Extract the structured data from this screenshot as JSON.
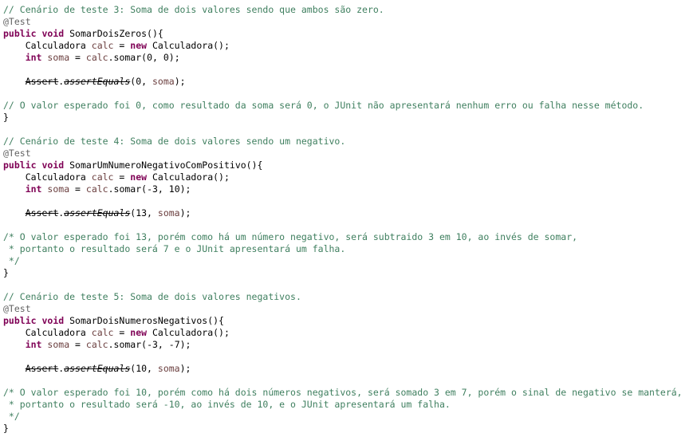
{
  "colors": {
    "background": "#ffffff",
    "comment": "#3f7f5f",
    "annotation": "#646464",
    "keyword": "#7f0055",
    "variable": "#6a3e3e",
    "plain": "#000000"
  },
  "code_lines": [
    [
      {
        "t": "// Cenário de teste 3: Soma de dois valores sendo que ambos são zero.",
        "c": "comment"
      }
    ],
    [
      {
        "t": "@Test",
        "c": "annotation"
      }
    ],
    [
      {
        "t": "public",
        "c": "keyword"
      },
      {
        "t": " ",
        "c": "plain"
      },
      {
        "t": "void",
        "c": "keyword"
      },
      {
        "t": " SomarDoisZeros(){",
        "c": "plain"
      }
    ],
    [
      {
        "t": "    Calculadora ",
        "c": "plain"
      },
      {
        "t": "calc",
        "c": "var"
      },
      {
        "t": " = ",
        "c": "plain"
      },
      {
        "t": "new",
        "c": "keyword"
      },
      {
        "t": " Calculadora();",
        "c": "plain"
      }
    ],
    [
      {
        "t": "    ",
        "c": "plain"
      },
      {
        "t": "int",
        "c": "keyword"
      },
      {
        "t": " ",
        "c": "plain"
      },
      {
        "t": "soma",
        "c": "var"
      },
      {
        "t": " = ",
        "c": "plain"
      },
      {
        "t": "calc",
        "c": "var"
      },
      {
        "t": ".somar(0, 0);",
        "c": "plain"
      }
    ],
    [],
    [
      {
        "t": "    ",
        "c": "plain"
      },
      {
        "t": "Assert",
        "c": "deprecated"
      },
      {
        "t": ".",
        "c": "plain"
      },
      {
        "t": "assertEquals",
        "c": "deprecated-italic"
      },
      {
        "t": "(0, ",
        "c": "plain"
      },
      {
        "t": "soma",
        "c": "var"
      },
      {
        "t": ");",
        "c": "plain"
      }
    ],
    [],
    [
      {
        "t": "// O valor esperado foi 0, como resultado da soma será 0, o JUnit não apresentará nenhum erro ou falha nesse método.",
        "c": "comment"
      }
    ],
    [
      {
        "t": "}",
        "c": "plain"
      }
    ],
    [],
    [
      {
        "t": "// Cenário de teste 4: Soma de dois valores sendo um negativo.",
        "c": "comment"
      }
    ],
    [
      {
        "t": "@Test",
        "c": "annotation"
      }
    ],
    [
      {
        "t": "public",
        "c": "keyword"
      },
      {
        "t": " ",
        "c": "plain"
      },
      {
        "t": "void",
        "c": "keyword"
      },
      {
        "t": " SomarUmNumeroNegativoComPositivo(){",
        "c": "plain"
      }
    ],
    [
      {
        "t": "    Calculadora ",
        "c": "plain"
      },
      {
        "t": "calc",
        "c": "var"
      },
      {
        "t": " = ",
        "c": "plain"
      },
      {
        "t": "new",
        "c": "keyword"
      },
      {
        "t": " Calculadora();",
        "c": "plain"
      }
    ],
    [
      {
        "t": "    ",
        "c": "plain"
      },
      {
        "t": "int",
        "c": "keyword"
      },
      {
        "t": " ",
        "c": "plain"
      },
      {
        "t": "soma",
        "c": "var"
      },
      {
        "t": " = ",
        "c": "plain"
      },
      {
        "t": "calc",
        "c": "var"
      },
      {
        "t": ".somar(-3, 10);",
        "c": "plain"
      }
    ],
    [],
    [
      {
        "t": "    ",
        "c": "plain"
      },
      {
        "t": "Assert",
        "c": "deprecated"
      },
      {
        "t": ".",
        "c": "plain"
      },
      {
        "t": "assertEquals",
        "c": "deprecated-italic"
      },
      {
        "t": "(13, ",
        "c": "plain"
      },
      {
        "t": "soma",
        "c": "var"
      },
      {
        "t": ");",
        "c": "plain"
      }
    ],
    [],
    [
      {
        "t": "/* O valor esperado foi 13, porém como há um número negativo, será subtraido 3 em 10, ao invés de somar,",
        "c": "comment"
      }
    ],
    [
      {
        "t": " * portanto o resultado será 7 e o JUnit apresentará um falha.",
        "c": "comment"
      }
    ],
    [
      {
        "t": " */",
        "c": "comment"
      }
    ],
    [
      {
        "t": "}",
        "c": "plain"
      }
    ],
    [],
    [
      {
        "t": "// Cenário de teste 5: Soma de dois valores negativos.",
        "c": "comment"
      }
    ],
    [
      {
        "t": "@Test",
        "c": "annotation"
      }
    ],
    [
      {
        "t": "public",
        "c": "keyword"
      },
      {
        "t": " ",
        "c": "plain"
      },
      {
        "t": "void",
        "c": "keyword"
      },
      {
        "t": " SomarDoisNumerosNegativos(){",
        "c": "plain"
      }
    ],
    [
      {
        "t": "    Calculadora ",
        "c": "plain"
      },
      {
        "t": "calc",
        "c": "var"
      },
      {
        "t": " = ",
        "c": "plain"
      },
      {
        "t": "new",
        "c": "keyword"
      },
      {
        "t": " Calculadora();",
        "c": "plain"
      }
    ],
    [
      {
        "t": "    ",
        "c": "plain"
      },
      {
        "t": "int",
        "c": "keyword"
      },
      {
        "t": " ",
        "c": "plain"
      },
      {
        "t": "soma",
        "c": "var"
      },
      {
        "t": " = ",
        "c": "plain"
      },
      {
        "t": "calc",
        "c": "var"
      },
      {
        "t": ".somar(-3, -7);",
        "c": "plain"
      }
    ],
    [],
    [
      {
        "t": "    ",
        "c": "plain"
      },
      {
        "t": "Assert",
        "c": "deprecated"
      },
      {
        "t": ".",
        "c": "plain"
      },
      {
        "t": "assertEquals",
        "c": "deprecated-italic"
      },
      {
        "t": "(10, ",
        "c": "plain"
      },
      {
        "t": "soma",
        "c": "var"
      },
      {
        "t": ");",
        "c": "plain"
      }
    ],
    [],
    [
      {
        "t": "/* O valor esperado foi 10, porém como há dois números negativos, será somado 3 em 7, porém o sinal de negativo se manterá,",
        "c": "comment"
      }
    ],
    [
      {
        "t": " * portanto o resultado será -10, ao invés de 10, e o JUnit apresentará um falha.",
        "c": "comment"
      }
    ],
    [
      {
        "t": " */",
        "c": "comment"
      }
    ],
    [
      {
        "t": "}",
        "c": "plain"
      }
    ]
  ]
}
